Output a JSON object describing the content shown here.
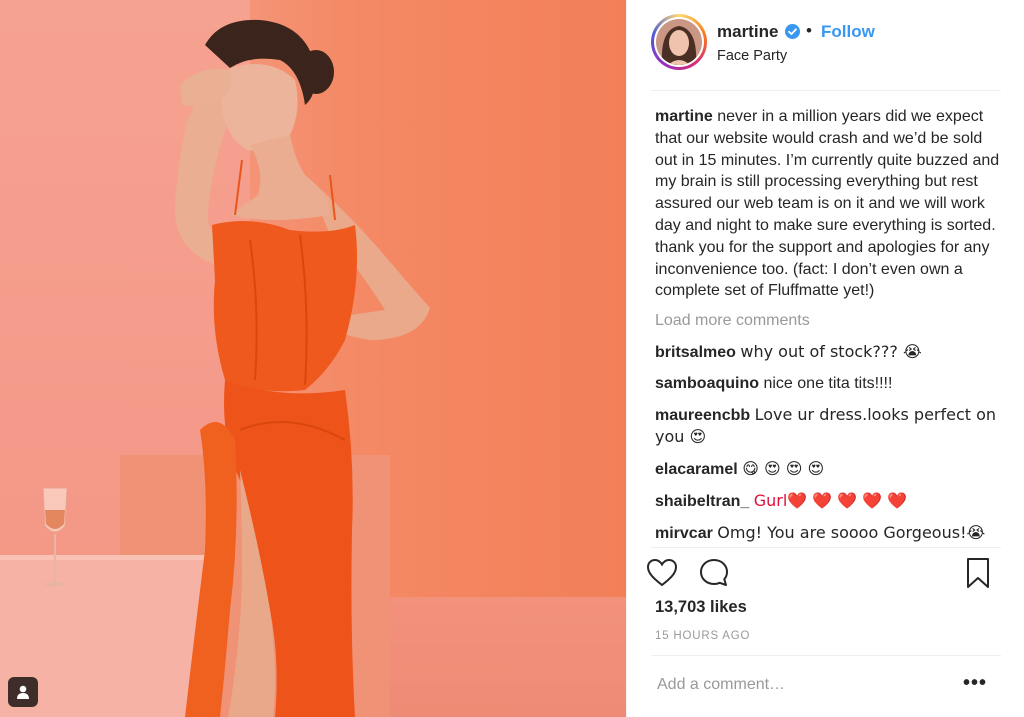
{
  "post": {
    "username": "martine",
    "separator": "•",
    "follow_label": "Follow",
    "location": "Face Party",
    "caption_user": "martine",
    "caption_text": "never in a million years did we expect that our website would crash and we’d be sold out in 15 minutes. I’m currently quite buzzed and my brain is still processing everything but rest assured our web team is on it and we will work day and night to make sure everything is sorted. thank you for the support and apologies for any inconvenience too. (fact: I don’t even own a complete set of Fluffmatte yet!)",
    "load_more": "Load more comments",
    "comments": [
      {
        "user": "britsalmeo",
        "text": "why out of stock??? 😭"
      },
      {
        "user": "samboaquino",
        "text": "nice one tita tits!!!!"
      },
      {
        "user": "maureencbb",
        "text": "Love ur dress.looks perfect on you 😍"
      },
      {
        "user": "elacaramel",
        "text": "😋 😍 😍 😍"
      },
      {
        "user": "shaibeltran_",
        "text": "Gurl❤️ ❤️ ❤️ ❤️ ❤️"
      },
      {
        "user": "mirvcar",
        "text": "Omg! You are soooo Gorgeous!😭"
      }
    ],
    "likes": "13,703 likes",
    "timestamp": "15 HOURS AGO",
    "add_comment_placeholder": "Add a comment…",
    "more_label": "•••"
  },
  "icons": {
    "heart": "heart-icon",
    "comment": "comment-icon",
    "bookmark": "bookmark-icon",
    "verified": "verified-badge-icon",
    "user_tag": "user-tag-icon"
  },
  "colors": {
    "accent": "#3897f0",
    "text": "#262626",
    "muted": "#999999",
    "photo_background": "#f27f58",
    "dress": "#f05a1e"
  }
}
